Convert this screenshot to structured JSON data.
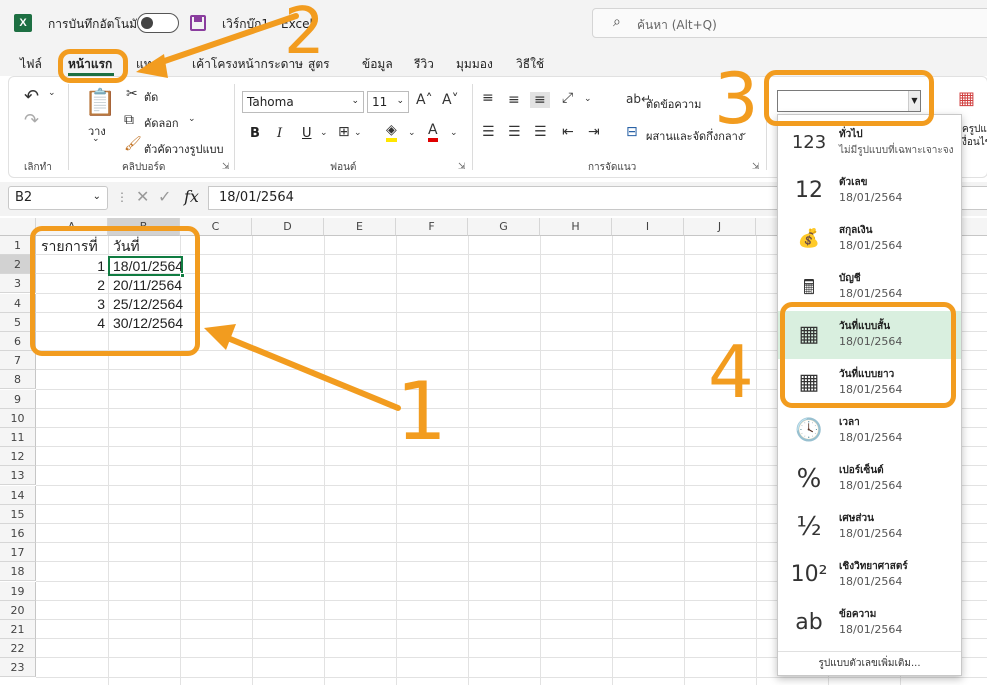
{
  "titlebar": {
    "app_icon": "X",
    "autosave_label": "การบันทึกอัตโนมัติ",
    "doc_title": "เวิร์กบุ๊ก1  -  Excel",
    "search_placeholder": "ค้นหา (Alt+Q)"
  },
  "menu": {
    "tabs": [
      "ไฟล์",
      "หน้าแรก",
      "แท",
      "เค้าโครงหน้ากระดาษ",
      "สูตร",
      "ข้อมูล",
      "รีวิว",
      "มุมมอง",
      "วิธีใช้"
    ]
  },
  "ribbon": {
    "undo_group": "เลิกทำ",
    "clipboard": {
      "paste": "วาง",
      "cut": "ตัด",
      "copy": "คัดลอก",
      "format_painter": "ตัวคัดวางรูปแบบ",
      "label": "คลิปบอร์ด"
    },
    "font": {
      "name": "Tahoma",
      "size": "11",
      "bold": "B",
      "italic": "I",
      "underline": "U",
      "label": "ฟอนต์"
    },
    "alignment": {
      "wrap_text": "ตัดข้อความ",
      "merge_center": "ผสานและจัดกึ่งกลาง",
      "label": "การจัดแนว"
    },
    "styles_partial_1": "ครูปแ",
    "styles_partial_2": "งื่อนไข"
  },
  "formula_bar": {
    "name_box": "B2",
    "fx": "fx",
    "value": "18/01/2564"
  },
  "grid": {
    "columns": [
      "A",
      "B",
      "C",
      "D",
      "E",
      "F",
      "G",
      "H",
      "I",
      "J"
    ],
    "rows": [
      "1",
      "2",
      "3",
      "4",
      "5",
      "6",
      "7",
      "8",
      "9",
      "10",
      "11",
      "12",
      "13",
      "14",
      "15",
      "16",
      "17",
      "18",
      "19",
      "20",
      "21",
      "22",
      "23"
    ],
    "headers": [
      "รายการที่",
      "วันที่"
    ],
    "data": [
      {
        "no": "1",
        "date": "18/01/2564"
      },
      {
        "no": "2",
        "date": "20/11/2564"
      },
      {
        "no": "3",
        "date": "25/12/2564"
      },
      {
        "no": "4",
        "date": "30/12/2564"
      }
    ]
  },
  "number_format_dropdown": {
    "items": [
      {
        "glyph": "123",
        "name": "ทั่วไป",
        "sample": "ไม่มีรูปแบบที่เฉพาะเจาะจง",
        "icon": "general-123-icon"
      },
      {
        "glyph": "12",
        "name": "ตัวเลข",
        "sample": "18/01/2564",
        "icon": "number-12-icon"
      },
      {
        "glyph": "💰",
        "name": "สกุลเงิน",
        "sample": "18/01/2564",
        "icon": "currency-icon"
      },
      {
        "glyph": "🖩",
        "name": "บัญชี",
        "sample": "18/01/2564",
        "icon": "accounting-icon"
      },
      {
        "glyph": "▦",
        "name": "วันที่แบบสั้น",
        "sample": "18/01/2564",
        "icon": "calendar-short-icon"
      },
      {
        "glyph": "▦",
        "name": "วันที่แบบยาว",
        "sample": "18/01/2564",
        "icon": "calendar-long-icon"
      },
      {
        "glyph": "🕓",
        "name": "เวลา",
        "sample": "18/01/2564",
        "icon": "clock-icon"
      },
      {
        "glyph": "%",
        "name": "เปอร์เซ็นต์",
        "sample": "18/01/2564",
        "icon": "percent-icon"
      },
      {
        "glyph": "½",
        "name": "เศษส่วน",
        "sample": "18/01/2564",
        "icon": "fraction-icon"
      },
      {
        "glyph": "10²",
        "name": "เชิงวิทยาศาสตร์",
        "sample": "18/01/2564",
        "icon": "scientific-icon"
      },
      {
        "glyph": "ab",
        "name": "ข้อความ",
        "sample": "18/01/2564",
        "icon": "text-ab-icon"
      }
    ],
    "more": "รูปแบบตัวเลขเพิ่มเติม..."
  },
  "annotations": [
    "1",
    "2",
    "3",
    "4"
  ],
  "colors": {
    "accent": "#107c41",
    "annotation": "#f29c1f",
    "highlight": "#d9efdf"
  }
}
